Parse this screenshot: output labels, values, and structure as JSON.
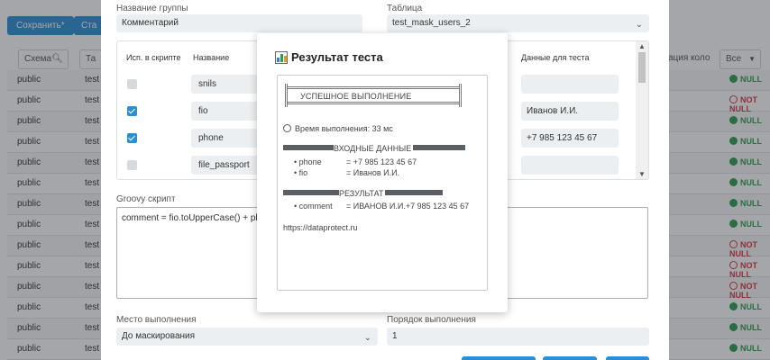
{
  "background": {
    "toolbar": {
      "save_label": "Сохранить*",
      "second_label": "Ста"
    },
    "filters": {
      "schema_placeholder": "Схема",
      "table_col": "Та",
      "col_label": "ация коло",
      "status_select": "Все"
    },
    "rows": [
      {
        "schema": "public",
        "t": "test",
        "status": "NULL",
        "ok": true
      },
      {
        "schema": "public",
        "t": "test",
        "status": "NOT NULL",
        "ok": false
      },
      {
        "schema": "public",
        "t": "test",
        "status": "NULL",
        "ok": true
      },
      {
        "schema": "public",
        "t": "test",
        "status": "NULL",
        "ok": true
      },
      {
        "schema": "public",
        "t": "test",
        "status": "NULL",
        "ok": true
      },
      {
        "schema": "public",
        "t": "test",
        "status": "NULL",
        "ok": true
      },
      {
        "schema": "public",
        "t": "test",
        "status": "NULL",
        "ok": true
      },
      {
        "schema": "public",
        "t": "test",
        "status": "NULL",
        "ok": true
      },
      {
        "schema": "public",
        "t": "test",
        "status": "NOT NULL",
        "ok": false
      },
      {
        "schema": "public",
        "t": "test",
        "status": "NOT NULL",
        "ok": false
      },
      {
        "schema": "public",
        "t": "test",
        "status": "NOT NULL",
        "ok": false
      },
      {
        "schema": "public",
        "t": "test",
        "status": "NULL",
        "ok": true
      },
      {
        "schema": "public",
        "t": "test",
        "status": "NULL",
        "ok": true
      },
      {
        "schema": "public",
        "t": "test",
        "status": "NULL",
        "ok": true
      }
    ]
  },
  "edit_dialog": {
    "group_name_label": "Название группы",
    "group_name_value": "Комментарий",
    "table_label": "Таблица",
    "table_value": "test_mask_users_2",
    "columns_header": {
      "use_in_script": "Исп. в скрипте",
      "name": "Название",
      "test_data": "Данные для теста"
    },
    "columns": [
      {
        "name": "snils",
        "checked": false,
        "test_data": ""
      },
      {
        "name": "fio",
        "checked": true,
        "test_data": "Иванов И.И."
      },
      {
        "name": "phone",
        "checked": true,
        "test_data": "+7 985 123 45 67"
      },
      {
        "name": "file_passport",
        "checked": false,
        "test_data": ""
      }
    ],
    "groovy_label": "Groovy скрипт",
    "groovy_code": "comment = fio.toUpperCase() + phone",
    "exec_place_label": "Место выполнения",
    "exec_place_value": "До маскирования",
    "exec_order_label": "Порядок выполнения",
    "exec_order_value": "1"
  },
  "result_modal": {
    "title": "Результат теста",
    "icon": "bar-chart-icon",
    "success_text": "УСПЕШНОЕ ВЫПОЛНЕНИЕ",
    "exec_time": "Время выполнения: 33 мс",
    "input_header": "ВХОДНЫЕ ДАННЫЕ",
    "inputs": [
      {
        "key": "• phone",
        "value": "= +7 985 123 45 67"
      },
      {
        "key": "• fio",
        "value": "= Иванов И.И."
      }
    ],
    "result_header": "РЕЗУЛЬТАТ",
    "results": [
      {
        "key": "• comment",
        "value": "= ИВАНОВ И.И.+7 985 123 45 67"
      }
    ],
    "link": "https://dataprotect.ru"
  },
  "colors": {
    "accent": "#2a8fd6",
    "ok": "#2e9e4f",
    "bad": "#d0393e"
  }
}
